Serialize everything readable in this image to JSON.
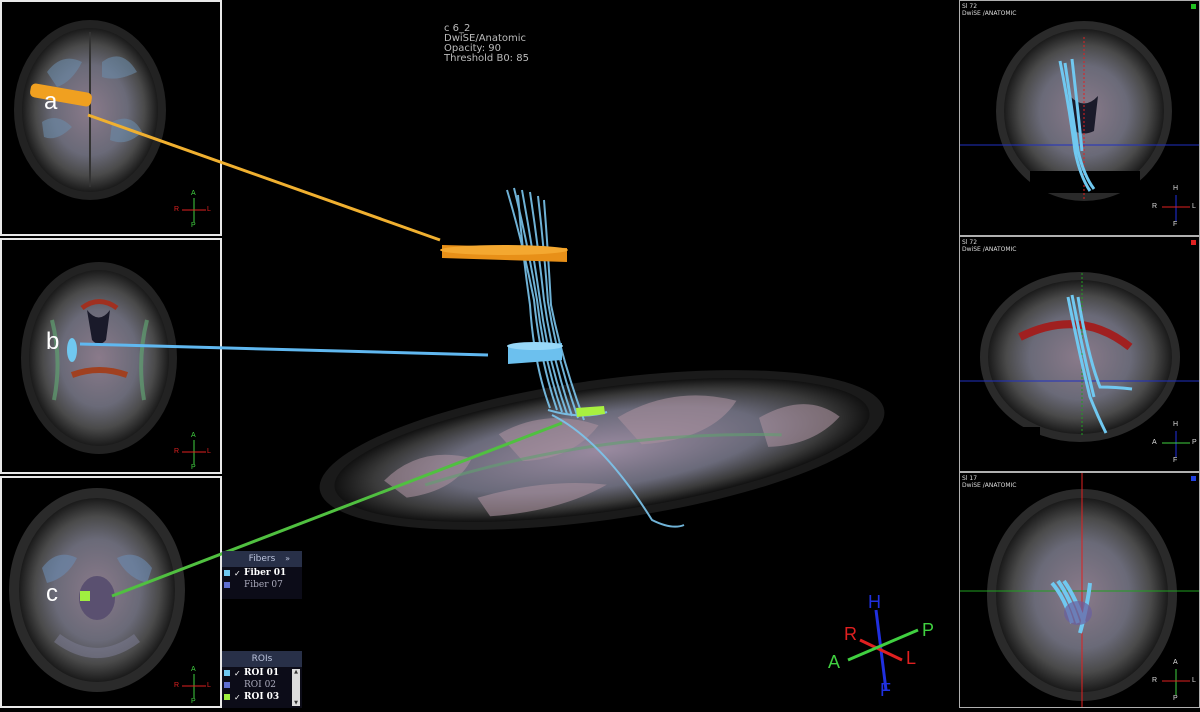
{
  "viewer": {
    "info_lines": [
      "c 6_2",
      "DwiSE/Anatomic",
      "Opacity: 90",
      "Threshold B0: 85"
    ]
  },
  "left_panels": [
    {
      "label": "a",
      "roi_color": "#f0a020",
      "line_color": "#f0b030",
      "orientation": {
        "top": "A",
        "left": "R",
        "right": "L",
        "bottom": "P"
      }
    },
    {
      "label": "b",
      "roi_color": "#70c8f0",
      "line_color": "#60b8f0",
      "orientation": {
        "top": "A",
        "left": "R",
        "right": "L",
        "bottom": "P"
      }
    },
    {
      "label": "c",
      "roi_color": "#a0f040",
      "line_color": "#60c040",
      "orientation": {
        "top": "A",
        "left": "R",
        "right": "L",
        "bottom": "P"
      }
    }
  ],
  "right_panels": [
    {
      "header_line1": "Sl 72",
      "header_line2": "DwiSE   /ANATOMIC",
      "indicator_color": "#20c020",
      "orientation": {
        "top": "H",
        "left": "R",
        "right": "L",
        "bottom": "F"
      }
    },
    {
      "header_line1": "Sl 72",
      "header_line2": "DwiSE   /ANATOMIC",
      "indicator_color": "#e02020",
      "orientation": {
        "top": "H",
        "left": "A",
        "right": "P",
        "bottom": "F"
      }
    },
    {
      "header_line1": "Sl 17",
      "header_line2": "DwiSE   /ANATOMIC",
      "indicator_color": "#2040e0",
      "orientation": {
        "top": "A",
        "left": "R",
        "right": "L",
        "bottom": "P"
      }
    }
  ],
  "fibers_panel": {
    "title": "Fibers",
    "items": [
      {
        "label": "Fiber 01",
        "checked": true,
        "color": "#70c8f0"
      },
      {
        "label": "Fiber 07",
        "checked": false,
        "color": "#6070d0"
      }
    ]
  },
  "rois_panel": {
    "title": "ROIs",
    "items": [
      {
        "label": "ROI 01",
        "checked": true,
        "color": "#70c8f0"
      },
      {
        "label": "ROI 02",
        "checked": false,
        "color": "#6070d0"
      },
      {
        "label": "ROI 03",
        "checked": true,
        "color": "#a0f040"
      }
    ]
  },
  "orientation_3d": {
    "H": "H",
    "F": "F",
    "R": "R",
    "L": "L",
    "A": "A",
    "P": "P",
    "colors": {
      "HF": "#2030e0",
      "RL": "#e02020",
      "AP": "#40d040"
    }
  }
}
